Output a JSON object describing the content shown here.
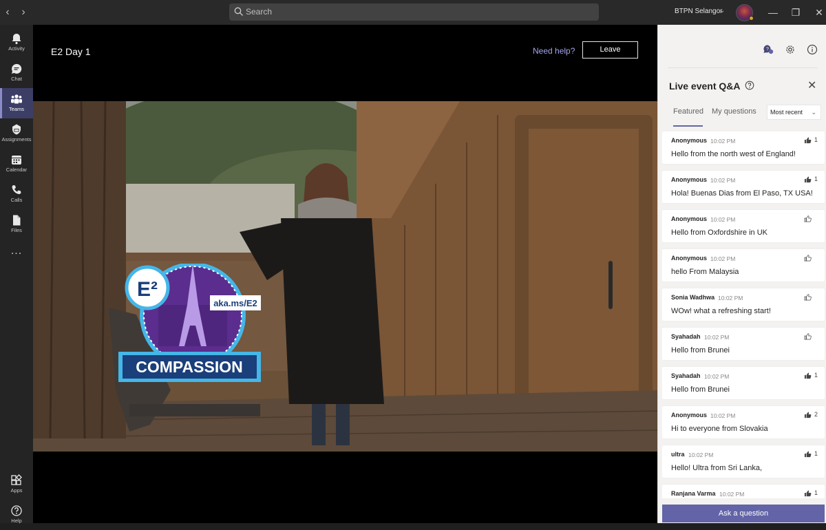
{
  "titlebar": {
    "search_placeholder": "Search",
    "org_name": "BTPN Selangor",
    "back_icon": "chevron-left-icon",
    "forward_icon": "chevron-right-icon",
    "minimize_glyph": "—",
    "maximize_glyph": "❐",
    "close_glyph": "✕"
  },
  "rail": {
    "items": [
      {
        "label": "Activity",
        "icon": "bell-icon"
      },
      {
        "label": "Chat",
        "icon": "chat-icon"
      },
      {
        "label": "Teams",
        "icon": "teams-icon",
        "active": true
      },
      {
        "label": "Assignments",
        "icon": "assignments-icon"
      },
      {
        "label": "Calendar",
        "icon": "calendar-icon"
      },
      {
        "label": "Calls",
        "icon": "phone-icon"
      },
      {
        "label": "Files",
        "icon": "file-icon"
      }
    ],
    "more": "...",
    "bottom": [
      {
        "label": "Apps",
        "icon": "apps-icon"
      },
      {
        "label": "Help",
        "icon": "help-icon"
      }
    ]
  },
  "event": {
    "title": "E2 Day 1",
    "help_link": "Need help?",
    "leave_label": "Leave"
  },
  "video": {
    "badge_logo": "E²",
    "badge_url": "aka.ms/E2",
    "badge_word": "COMPASSION"
  },
  "qa": {
    "title": "Live event Q&A",
    "tabs": [
      "Featured",
      "My questions"
    ],
    "active_tab": "Featured",
    "sort_label": "Most recent",
    "ask_label": "Ask a question",
    "questions": [
      {
        "author": "Anonymous",
        "time": "10:02 PM",
        "text": "Hello from the north west of England!",
        "likes": "1",
        "liked": true
      },
      {
        "author": "Anonymous",
        "time": "10:02 PM",
        "text": "Hola! Buenas Dias from El Paso, TX USA!",
        "likes": "1",
        "liked": true
      },
      {
        "author": "Anonymous",
        "time": "10:02 PM",
        "text": "Hello from Oxfordshire in UK",
        "likes": "",
        "liked": false
      },
      {
        "author": "Anonymous",
        "time": "10:02 PM",
        "text": "hello From Malaysia",
        "likes": "",
        "liked": false
      },
      {
        "author": "Sonia Wadhwa",
        "time": "10:02 PM",
        "text": "WOw! what a refreshing start!",
        "likes": "",
        "liked": false
      },
      {
        "author": "Syahadah",
        "time": "10:02 PM",
        "text": "Hello from Brunei",
        "likes": "",
        "liked": false
      },
      {
        "author": "Syahadah",
        "time": "10:02 PM",
        "text": "Hello from Brunei",
        "likes": "1",
        "liked": true
      },
      {
        "author": "Anonymous",
        "time": "10:02 PM",
        "text": "Hi to everyone from Slovakia",
        "likes": "2",
        "liked": true
      },
      {
        "author": "ultra",
        "time": "10:02 PM",
        "text": "Hello! Ultra from Sri Lanka,",
        "likes": "1",
        "liked": true
      },
      {
        "author": "Ranjana Varma",
        "time": "10:02 PM",
        "text": "",
        "likes": "1",
        "liked": true
      }
    ]
  },
  "colors": {
    "accent": "#6264a7",
    "rail_bg": "#242424",
    "panel_bg": "#f3f2f1"
  }
}
